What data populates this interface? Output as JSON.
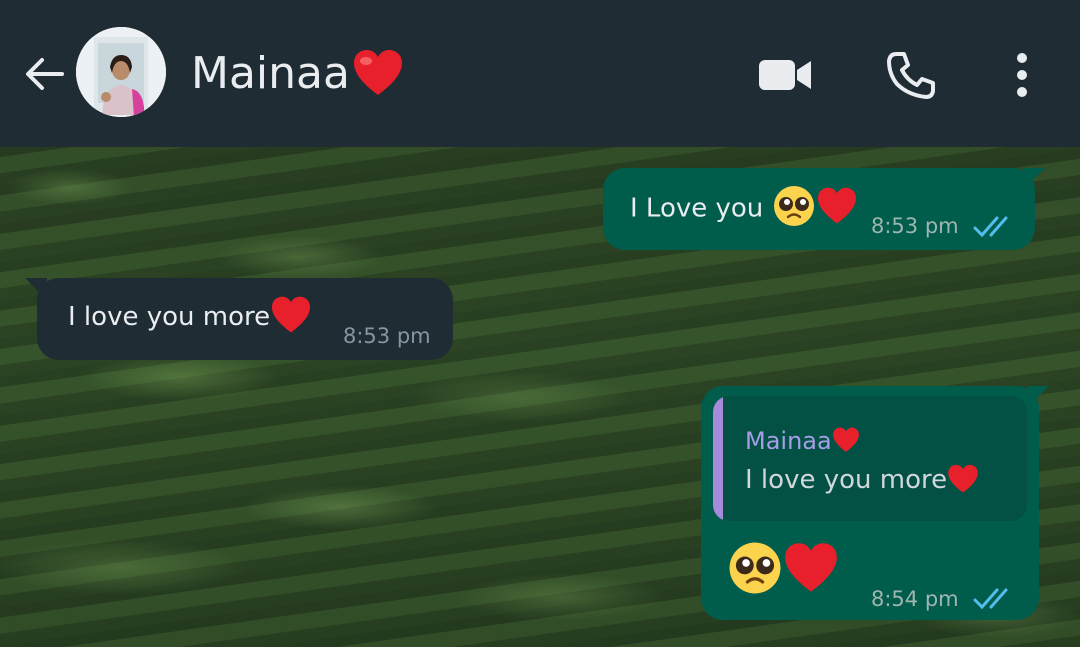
{
  "header": {
    "contact_name": "Mainaa",
    "contact_emoji": "❤️",
    "icons": [
      "back-arrow-icon",
      "video-call-icon",
      "voice-call-icon",
      "more-options-icon"
    ]
  },
  "messages": [
    {
      "direction": "outgoing",
      "text": "I Love you",
      "emoji": "🥺❤️",
      "time": "8:53 pm",
      "status": "read"
    },
    {
      "direction": "incoming",
      "text": "I love you more",
      "emoji": "❤️",
      "time": "8:53 pm"
    },
    {
      "direction": "outgoing",
      "reply_to": {
        "name": "Mainaa",
        "name_emoji": "❤️",
        "text": "I love you more",
        "text_emoji": "❤️"
      },
      "emoji": "🥺❤️",
      "time": "8:54 pm",
      "status": "read"
    }
  ],
  "colors": {
    "header_bg": "#1f2c34",
    "outgoing_bubble": "#005c4b",
    "incoming_bubble": "#1f2c34",
    "read_ticks": "#53bdeb",
    "quote_bar": "#a78bdb"
  }
}
